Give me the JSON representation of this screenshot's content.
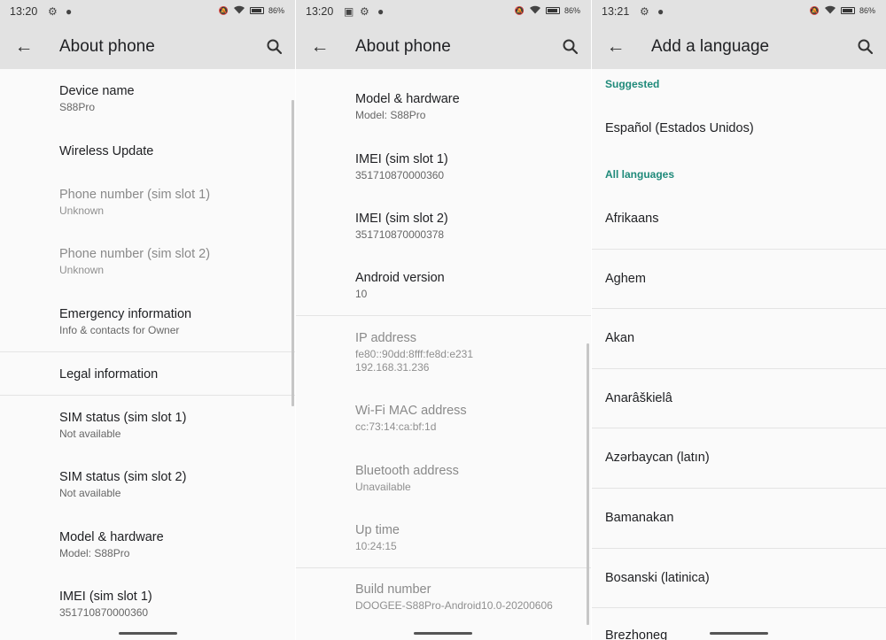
{
  "screen1": {
    "status": {
      "time": "13:20",
      "battery": "86%"
    },
    "toolbar": {
      "title": "About phone"
    },
    "items": [
      {
        "title": "Device name",
        "summary": "S88Pro"
      },
      {
        "title": "Wireless Update",
        "summary": ""
      },
      {
        "title": "Phone number (sim slot 1)",
        "summary": "Unknown"
      },
      {
        "title": "Phone number (sim slot 2)",
        "summary": "Unknown"
      },
      {
        "title": "Emergency information",
        "summary": "Info & contacts for Owner"
      },
      {
        "title": "Legal information",
        "summary": ""
      },
      {
        "title": "SIM status (sim slot 1)",
        "summary": "Not available"
      },
      {
        "title": "SIM status (sim slot 2)",
        "summary": "Not available"
      },
      {
        "title": "Model & hardware",
        "summary": "Model: S88Pro"
      },
      {
        "title": "IMEI (sim slot 1)",
        "summary": "351710870000360"
      }
    ]
  },
  "screen2": {
    "status": {
      "time": "13:20",
      "battery": "86%"
    },
    "toolbar": {
      "title": "About phone"
    },
    "items": [
      {
        "title": "Model & hardware",
        "summary": "Model: S88Pro"
      },
      {
        "title": "IMEI (sim slot 1)",
        "summary": "351710870000360"
      },
      {
        "title": "IMEI (sim slot 2)",
        "summary": "351710870000378"
      },
      {
        "title": "Android version",
        "summary": "10"
      },
      {
        "title": "IP address",
        "summary": "fe80::90dd:8fff:fe8d:e231",
        "summary2": "192.168.31.236"
      },
      {
        "title": "Wi-Fi MAC address",
        "summary": "cc:73:14:ca:bf:1d"
      },
      {
        "title": "Bluetooth address",
        "summary": "Unavailable"
      },
      {
        "title": "Up time",
        "summary": "10:24:15"
      },
      {
        "title": "Build number",
        "summary": "DOOGEE-S88Pro-Android10.0-20200606"
      }
    ]
  },
  "screen3": {
    "status": {
      "time": "13:21",
      "battery": "86%"
    },
    "toolbar": {
      "title": "Add a language"
    },
    "suggested_header": "Suggested",
    "suggested": [
      "Español (Estados Unidos)"
    ],
    "all_header": "All languages",
    "languages": [
      "Afrikaans",
      "Aghem",
      "Akan",
      "Anarâškielâ",
      "Azərbaycan (latın)",
      "Bamanakan",
      "Bosanski (latinica)",
      "Brezhoneg"
    ]
  }
}
